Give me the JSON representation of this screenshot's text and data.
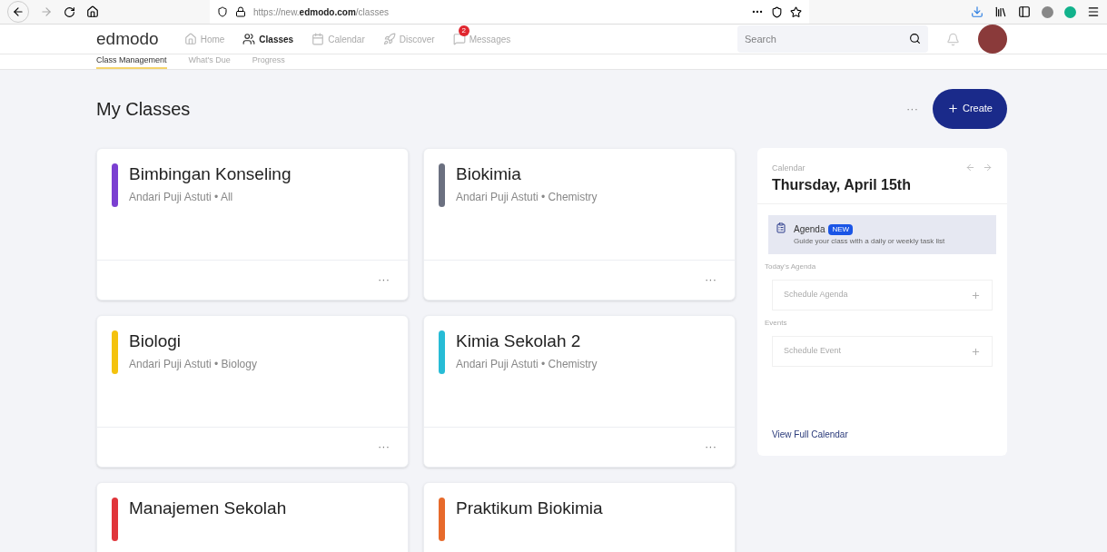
{
  "browser": {
    "url_host": "https://new.",
    "url_domain": "edmodo.com",
    "url_path": "/classes"
  },
  "nav": {
    "logo": "edmodo",
    "items": [
      {
        "label": "Home",
        "selected": false
      },
      {
        "label": "Classes",
        "selected": true
      },
      {
        "label": "Calendar",
        "selected": false
      },
      {
        "label": "Discover",
        "selected": false
      },
      {
        "label": "Messages",
        "selected": false,
        "badge": "2"
      }
    ],
    "search": {
      "placeholder": "Search"
    }
  },
  "subnav": [
    {
      "label": "Class Management",
      "selected": true
    },
    {
      "label": "What's Due",
      "selected": false
    },
    {
      "label": "Progress",
      "selected": false
    }
  ],
  "page": {
    "title": "My Classes",
    "more": "···",
    "create": "Create"
  },
  "classes": [
    {
      "name": "Bimbingan Konseling",
      "subtitle": "Andari Puji Astuti • All",
      "color": "#7b3fd1",
      "more": "···"
    },
    {
      "name": "Biokimia",
      "subtitle": "Andari Puji Astuti • Chemistry",
      "color": "#6b7080",
      "more": "···"
    },
    {
      "name": "Biologi",
      "subtitle": "Andari Puji Astuti • Biology",
      "color": "#f4c20d",
      "more": "···"
    },
    {
      "name": "Kimia Sekolah 2",
      "subtitle": "Andari Puji Astuti • Chemistry",
      "color": "#27bcd6",
      "more": "···"
    },
    {
      "name": "Manajemen Sekolah",
      "color": "#e0353b"
    },
    {
      "name": "Praktikum Biokimia",
      "color": "#e76a2b"
    }
  ],
  "calendar": {
    "label": "Calendar",
    "date": "Thursday, April 15th",
    "agenda": {
      "title": "Agenda",
      "badge": "NEW",
      "text": "Guide your class with a daily or weekly task list"
    },
    "sections": [
      {
        "heading": "Today's Agenda",
        "action": "Schedule Agenda"
      },
      {
        "heading": "Events",
        "action": "Schedule Event"
      }
    ],
    "link": "View Full Calendar"
  }
}
